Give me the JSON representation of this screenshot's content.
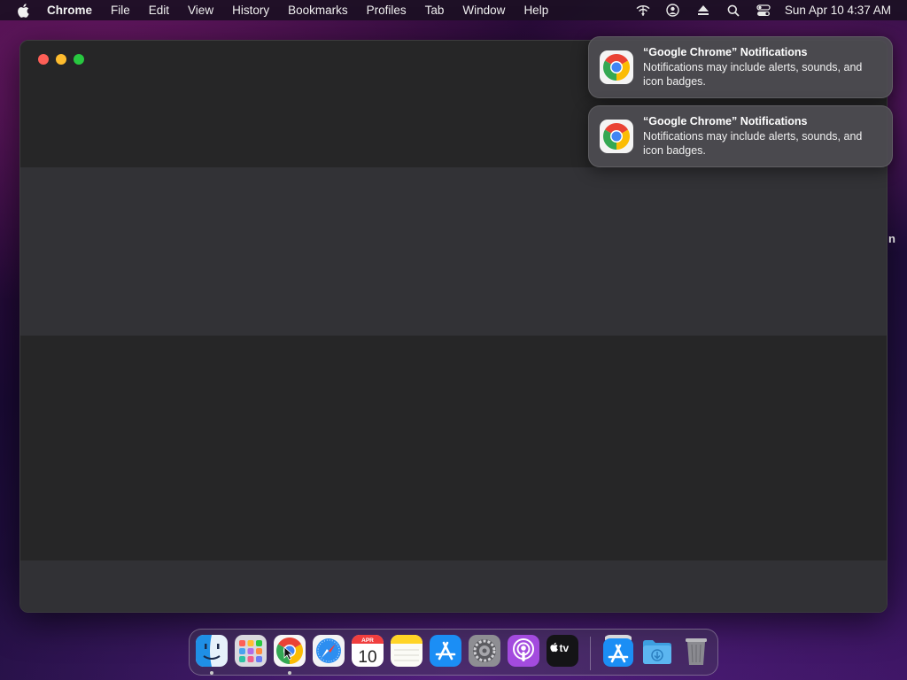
{
  "menubar": {
    "app_name": "Chrome",
    "items": [
      "File",
      "Edit",
      "View",
      "History",
      "Bookmarks",
      "Profiles",
      "Tab",
      "Window",
      "Help"
    ],
    "clock": "Sun Apr 10  4:37 AM",
    "status_icons": [
      "wifi-icon",
      "user-account-icon",
      "eject-icon",
      "search-icon",
      "control-center-icon"
    ]
  },
  "window": {
    "edge_fragment": "n"
  },
  "notifications": [
    {
      "title": "“Google Chrome” Notifications",
      "body": "Notifications may include alerts, sounds, and icon badges."
    },
    {
      "title": "“Google Chrome” Notifications",
      "body": "Notifications may include alerts, sounds, and icon badges."
    }
  ],
  "dock": {
    "apps": [
      "finder",
      "launchpad",
      "google-chrome",
      "safari",
      "calendar",
      "notes",
      "app-store",
      "system-preferences",
      "podcasts",
      "apple-tv",
      "app-store-downloads",
      "downloads-folder",
      "trash"
    ],
    "calendar_month": "APR",
    "calendar_day": "10",
    "tv_label": "tv",
    "running": [
      "finder",
      "google-chrome"
    ]
  },
  "colors": {
    "traffic_close": "#fe5f57",
    "traffic_minimize": "#febc2e",
    "traffic_maximize": "#28c840"
  }
}
